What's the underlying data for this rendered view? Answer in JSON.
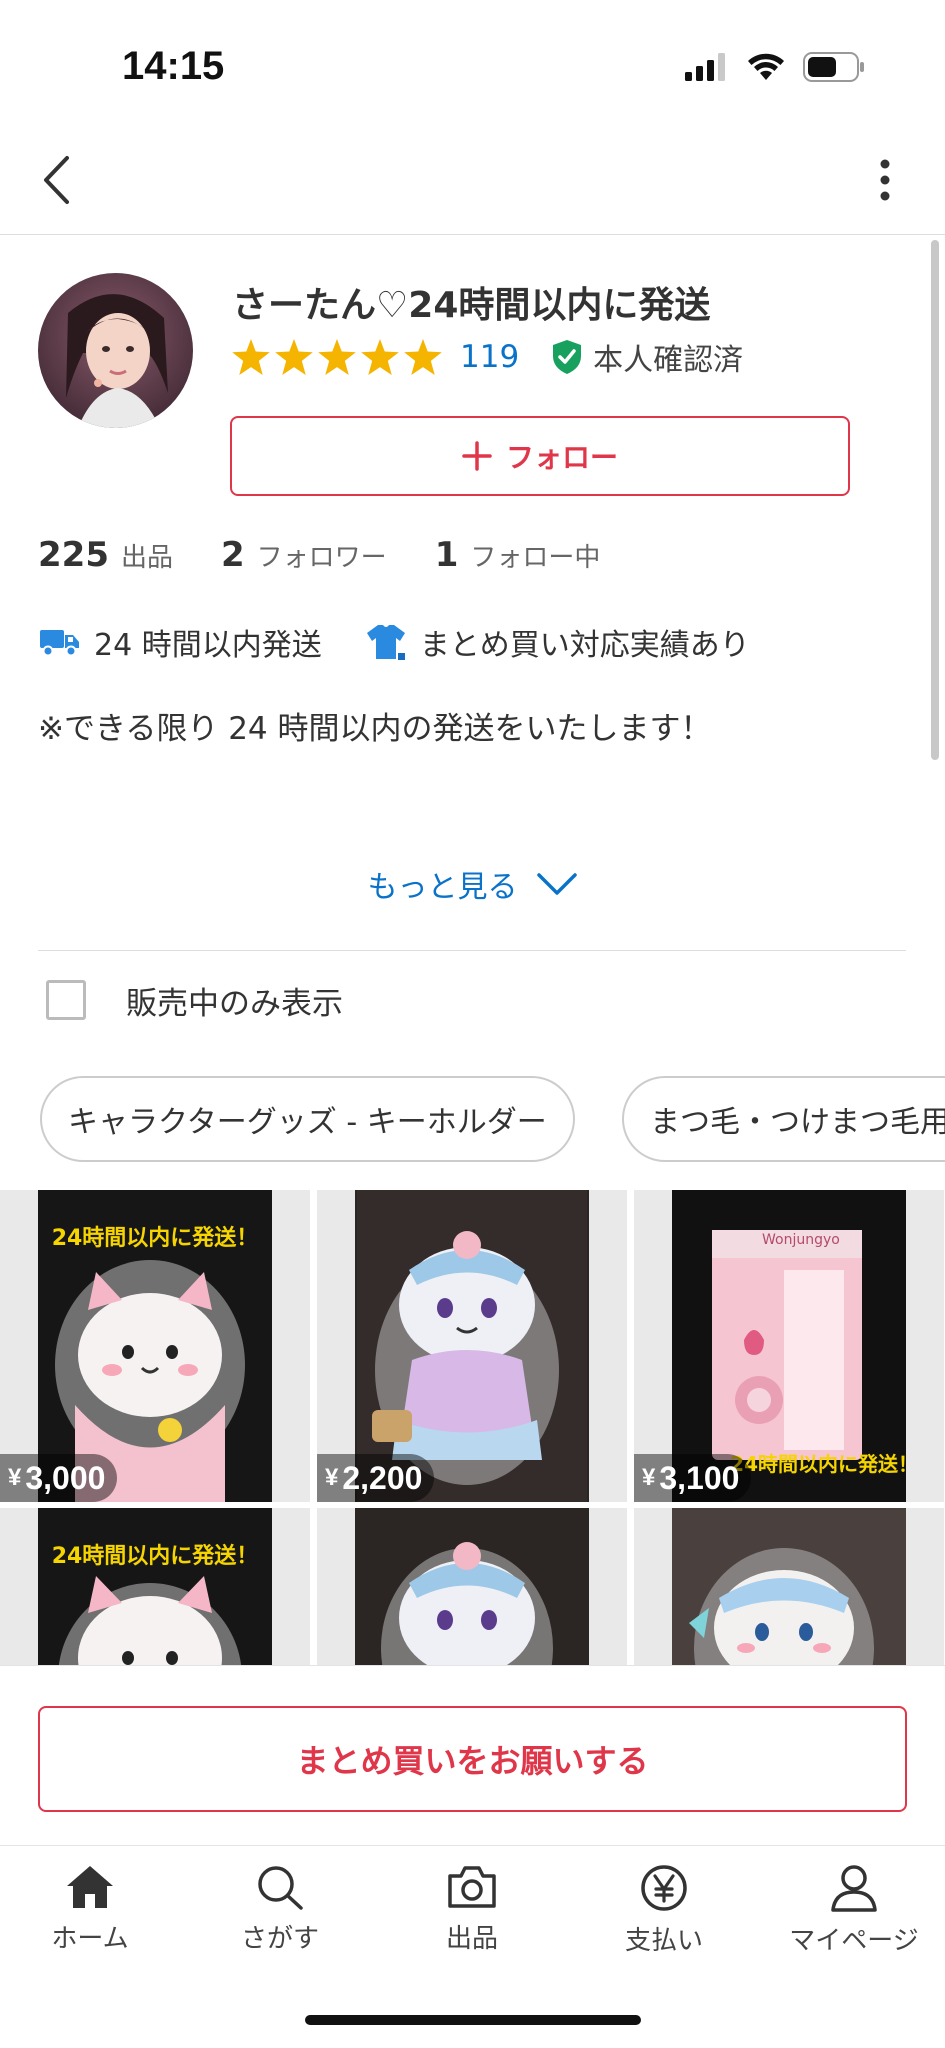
{
  "status_bar": {
    "time": "14:15"
  },
  "seller": {
    "name": "さーたん♡24時間以内に発送",
    "rating_count": "119",
    "verified_label": "本人確認済",
    "follow_label": "フォロー"
  },
  "stats": [
    {
      "value": "225",
      "label": "出品"
    },
    {
      "value": "2",
      "label": "フォロワー"
    },
    {
      "value": "1",
      "label": "フォロー中"
    }
  ],
  "badges": [
    {
      "label": "24 時間以内発送",
      "icon": "truck-icon"
    },
    {
      "label": "まとめ買い対応実績あり",
      "icon": "shirt-icon"
    }
  ],
  "description": "※できる限り 24 時間以内の発送をいたします！",
  "more_label": "もっと見る",
  "filter": {
    "label": "販売中のみ表示",
    "checked": false
  },
  "chips": [
    "キャラクターグッズ - キーホルダー",
    "まつ毛・つけまつ毛用品"
  ],
  "products": [
    {
      "price": "3,000",
      "banner": "24時間以内に発送！"
    },
    {
      "price": "2,200"
    },
    {
      "price": "3,100",
      "banner": "24時間以内に発送！",
      "package_text": "Wonjungyo"
    },
    {
      "banner": "24時間以内に発送！"
    },
    {},
    {}
  ],
  "currency_symbol": "¥",
  "bulk_button_label": "まとめ買いをお願いする",
  "tabs": [
    {
      "label": "ホーム",
      "icon": "home-icon",
      "active": true
    },
    {
      "label": "さがす",
      "icon": "search-icon"
    },
    {
      "label": "出品",
      "icon": "camera-icon"
    },
    {
      "label": "支払い",
      "icon": "yen-icon"
    },
    {
      "label": "マイページ",
      "icon": "person-icon"
    }
  ],
  "colors": {
    "accent_red": "#e0364a",
    "link_blue": "#0a73c9",
    "star_yellow": "#f5b400",
    "verified_green": "#18a05e"
  }
}
